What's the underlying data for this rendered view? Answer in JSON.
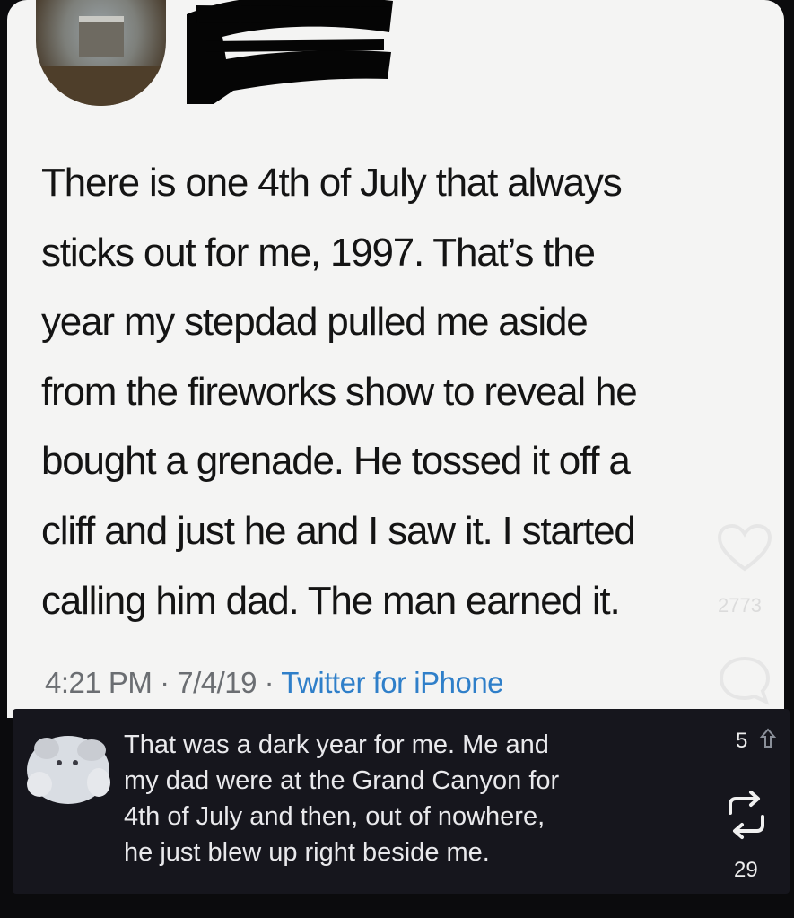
{
  "tweet": {
    "lines": [
      "There is one 4th of July that always",
      "sticks out for me, 1997. That’s the",
      "year my stepdad pulled me aside",
      "from the fireworks show to reveal he",
      "bought a grenade. He tossed it off a",
      "cliff and just he and I saw it. I started",
      "calling him dad. The man earned it."
    ],
    "time": "4:21 PM",
    "separator": "·",
    "date": "7/4/19",
    "source": "Twitter for iPhone"
  },
  "overlay": {
    "like_icon": "heart-icon",
    "like_count": "2773",
    "comment_icon": "comment-bubble-icon"
  },
  "reply": {
    "lines": [
      "That was a dark year for me. Me and",
      "my dad were at the Grand Canyon for",
      "4th of July and then, out of nowhere,",
      "he just blew up right beside me."
    ],
    "upvote_count": "5",
    "upvote_icon": "upvote-arrow-icon",
    "repost_icon": "repost-icon",
    "repost_count": "29"
  },
  "colors": {
    "card_bg": "#f4f4f3",
    "reply_bg": "#16161d",
    "link": "#2f7fc9",
    "meta": "#6b6e72"
  }
}
